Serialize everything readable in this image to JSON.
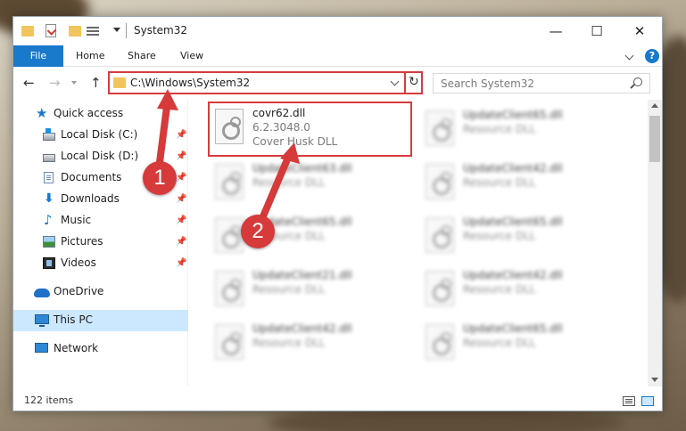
{
  "window": {
    "title": "System32",
    "caption": {
      "minimize": "—",
      "maximize": "☐",
      "close": "✕"
    }
  },
  "ribbon": {
    "file_tab": "File",
    "tabs": [
      "Home",
      "Share",
      "View"
    ],
    "help": "?"
  },
  "nav": {
    "back": "←",
    "forward": "→",
    "up": "↑",
    "address": "C:\\Windows\\System32",
    "refresh": "↻",
    "search_placeholder": "Search System32"
  },
  "sidebar": {
    "items": [
      {
        "label": "Quick access",
        "icon": "star-icon",
        "pinned": false
      },
      {
        "label": "Local Disk (C:)",
        "icon": "drive-c-icon",
        "pinned": true
      },
      {
        "label": "Local Disk (D:)",
        "icon": "drive-d-icon",
        "pinned": true
      },
      {
        "label": "Documents",
        "icon": "documents-icon",
        "pinned": true
      },
      {
        "label": "Downloads",
        "icon": "downloads-icon",
        "pinned": true
      },
      {
        "label": "Music",
        "icon": "music-icon",
        "pinned": true
      },
      {
        "label": "Pictures",
        "icon": "pictures-icon",
        "pinned": true
      },
      {
        "label": "Videos",
        "icon": "videos-icon",
        "pinned": true
      },
      {
        "label": "OneDrive",
        "icon": "onedrive-icon",
        "pinned": false
      },
      {
        "label": "This PC",
        "icon": "this-pc-icon",
        "pinned": false,
        "selected": true
      },
      {
        "label": "Network",
        "icon": "network-icon",
        "pinned": false
      }
    ],
    "pin_glyph": "📌"
  },
  "files": [
    {
      "name": "covr62.dll",
      "version": "6.2.3048.0",
      "description": "Cover Husk DLL",
      "highlight": true
    },
    {
      "name": "UpdateClient65.dll",
      "description": "Resource DLL"
    },
    {
      "name": "UpdateClient63.dll",
      "description": "Resource DLL"
    },
    {
      "name": "UpdateClient42.dll",
      "description": "Resource DLL"
    },
    {
      "name": "UpdateClient65.dll",
      "description": "Resource DLL"
    },
    {
      "name": "UpdateClient65.dll",
      "description": "Resource DLL"
    },
    {
      "name": "UpdateClient21.dll",
      "description": "Resource DLL"
    },
    {
      "name": "UpdateClient42.dll",
      "description": "Resource DLL"
    },
    {
      "name": "UpdateClient42.dll",
      "description": "Resource DLL"
    },
    {
      "name": "UpdateClient65.dll",
      "description": "Resource DLL"
    }
  ],
  "status": {
    "item_count": "122 items"
  },
  "annotations": {
    "step1": "1",
    "step2": "2",
    "color": "#d63a3a"
  },
  "colors": {
    "accent": "#1979ca",
    "highlight": "#d73b3e",
    "selection": "#cce8ff"
  }
}
